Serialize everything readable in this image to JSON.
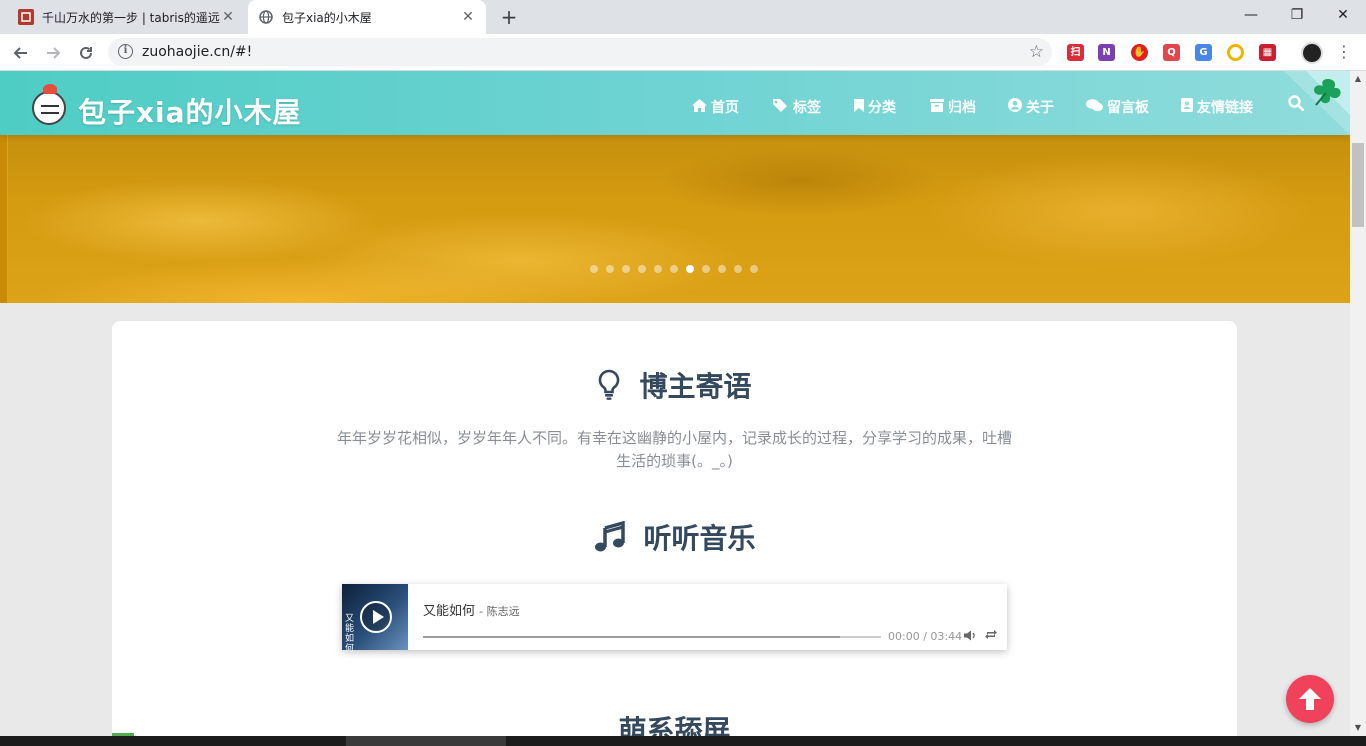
{
  "browser": {
    "tabs": [
      {
        "title": "千山万水的第一步 | tabris的遥远",
        "active": false,
        "favicon_color": "#b03a2e"
      },
      {
        "title": "包子xia的小木屋",
        "active": true,
        "favicon_icon": "globe-icon"
      }
    ],
    "new_tab": "+",
    "window_controls": {
      "minimize": "—",
      "restore": "❐",
      "close": "✕"
    },
    "address": "zuohaojie.cn/#!",
    "extensions": [
      {
        "name": "ext-red-icon",
        "color": "#d92d3a",
        "glyph": "扫"
      },
      {
        "name": "onenote-icon",
        "color": "#7b3fb0",
        "glyph": "N"
      },
      {
        "name": "adblock-icon",
        "color": "#e02020",
        "glyph": "✋"
      },
      {
        "name": "search-ext-icon",
        "color": "#e2464d",
        "glyph": "Q"
      },
      {
        "name": "translate-icon",
        "color": "#4a86e8",
        "glyph": "G"
      },
      {
        "name": "chrome-circle-icon",
        "color": "#f0b400",
        "glyph": "◎"
      },
      {
        "name": "grid-ext-icon",
        "color": "#cc1f2e",
        "glyph": "▦"
      }
    ]
  },
  "site": {
    "title": "包子xia的小木屋",
    "nav": [
      {
        "label": "首页",
        "icon": "home-icon"
      },
      {
        "label": "标签",
        "icon": "tags-icon"
      },
      {
        "label": "分类",
        "icon": "bookmark-icon"
      },
      {
        "label": "归档",
        "icon": "archive-icon"
      },
      {
        "label": "关于",
        "icon": "user-circle-icon"
      },
      {
        "label": "留言板",
        "icon": "comments-icon"
      },
      {
        "label": "友情链接",
        "icon": "address-book-icon"
      }
    ],
    "carousel": {
      "count": 11,
      "active_index": 6
    }
  },
  "main": {
    "motto_title": "博主寄语",
    "motto_text": "年年岁岁花相似，岁岁年年人不同。有幸在这幽静的小屋内，记录成长的过程，分享学习的成果，吐槽生活的琐事(。_。)",
    "music_title": "听听音乐",
    "player": {
      "song": "又能如何",
      "artist": "陈志远",
      "time": "00:00 / 03:44",
      "cover_text": "又能如何",
      "progress": 0.91
    },
    "next_title": "萌系舔屏"
  },
  "colors": {
    "header_start": "#4ecdc4",
    "header_end": "#90dcdc",
    "title_text": "#34495e",
    "totop": "#f1425c"
  }
}
